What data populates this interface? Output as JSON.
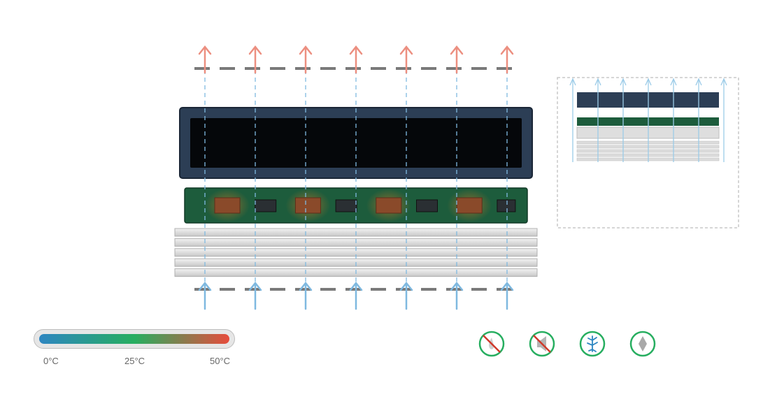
{
  "colors": {
    "cold": "#2e86c1",
    "mid": "#27ae60",
    "hot": "#e74c3c",
    "airflow_in": "#7fb9e0",
    "airflow_out": "#ec8f80",
    "screen_frame": "#2c3e55",
    "screen_panel": "#05070a",
    "pcb": "#1d5c3c",
    "heatsink": "#d8d8d8",
    "icon_ring": "#27ae60",
    "strike": "#d0392b"
  },
  "legend": {
    "min_label": "0°C",
    "mid_label": "25°C",
    "max_label": "50°C"
  },
  "icons": [
    {
      "name": "no-thermal-paste-icon",
      "struck": true
    },
    {
      "name": "no-speaker-icon",
      "struck": true
    },
    {
      "name": "cooling-flow-icon",
      "struck": false
    },
    {
      "name": "diamond-icon",
      "struck": false
    }
  ],
  "components": {
    "chips": [
      {
        "kind": "hot",
        "heat": 1.0
      },
      {
        "kind": "cool",
        "heat": 0.0
      },
      {
        "kind": "hot",
        "heat": 1.0
      },
      {
        "kind": "cool",
        "heat": 0.0
      },
      {
        "kind": "hot",
        "heat": 1.0
      },
      {
        "kind": "cool",
        "heat": 0.0
      },
      {
        "kind": "hot",
        "heat": 1.0
      },
      {
        "kind": "cool",
        "heat": 0.0
      }
    ],
    "fin_count": 5,
    "airflow_columns": 7
  }
}
